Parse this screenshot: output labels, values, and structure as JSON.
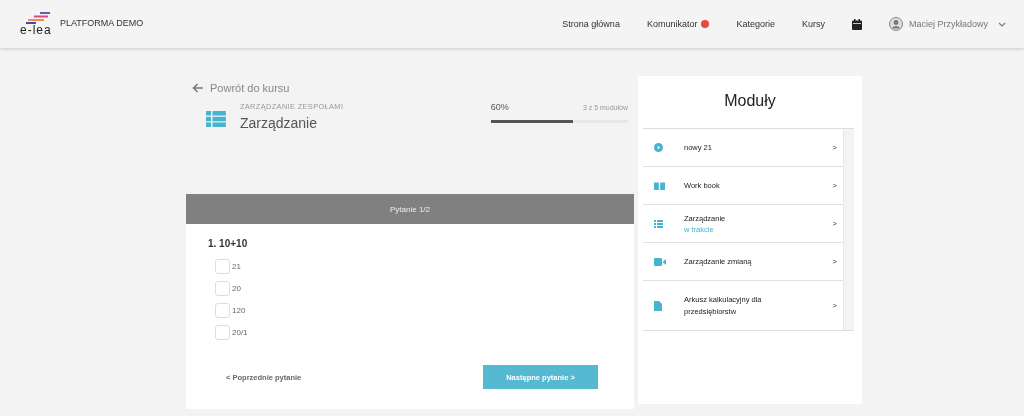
{
  "brand": {
    "logo": "e-lea",
    "name": "PLATFORMA DEMO"
  },
  "nav": [
    {
      "label": "Strona główna",
      "notification": false
    },
    {
      "label": "Komunikator",
      "notification": true
    },
    {
      "label": "Kategorie",
      "notification": false
    },
    {
      "label": "Kursy",
      "notification": false
    }
  ],
  "user": {
    "name": "Maciej Przykładowy"
  },
  "back_link": "Powrót do kursu",
  "lesson": {
    "course": "ZARZĄDZANIE ZESPOŁAMI",
    "title": "Zarządzanie",
    "percent": "60%",
    "count": "3 z 5 modułów",
    "level": 0.6
  },
  "quiz": {
    "header": "Pytanie 1/2",
    "question": "1. 10+10",
    "answers": [
      {
        "label": "21",
        "checked": false
      },
      {
        "label": "20",
        "checked": false
      },
      {
        "label": "120",
        "checked": false
      },
      {
        "label": "20/1",
        "checked": false
      }
    ],
    "prev": "< Poprzednie pytanie",
    "next": "Następne pytanie >"
  },
  "modules": {
    "title": "Moduły",
    "items": [
      {
        "kind": "play",
        "title": "nowy 21",
        "chevron": ">"
      },
      {
        "kind": "book",
        "title": "Work book",
        "chevron": ">"
      },
      {
        "kind": "list",
        "title": "Zarządzanie",
        "status": "w trakcie",
        "chevron": ">"
      },
      {
        "kind": "video",
        "title": "Zarządzanie zmianą",
        "chevron": ">"
      },
      {
        "kind": "file",
        "title": "Arkusz kalkulacyjny dla przedsiębiorstw",
        "chevron": ">"
      }
    ]
  }
}
